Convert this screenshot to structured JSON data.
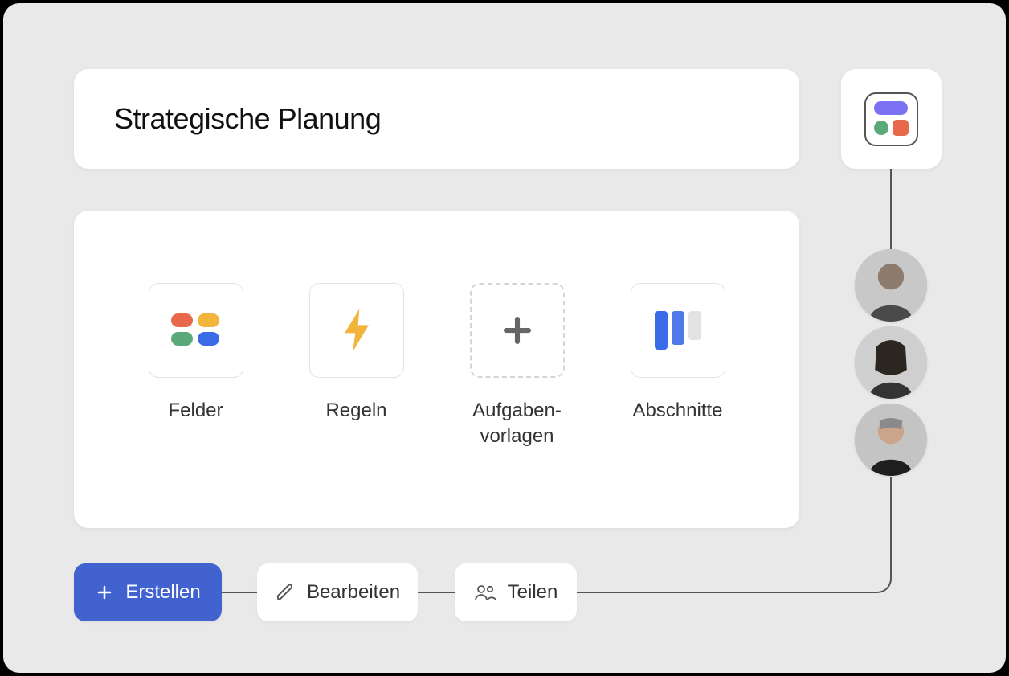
{
  "title": "Strategische Planung",
  "options": {
    "fields": "Felder",
    "rules": "Regeln",
    "task_templates": "Aufgaben-\nvorlagen",
    "sections": "Abschnitte"
  },
  "buttons": {
    "create": "Erstellen",
    "edit": "Bearbeiten",
    "share": "Teilen"
  },
  "avatars": [
    {
      "name": "user-1"
    },
    {
      "name": "user-2"
    },
    {
      "name": "user-3"
    }
  ],
  "colors": {
    "primary": "#4262d0",
    "bg": "#e9e9e9"
  }
}
